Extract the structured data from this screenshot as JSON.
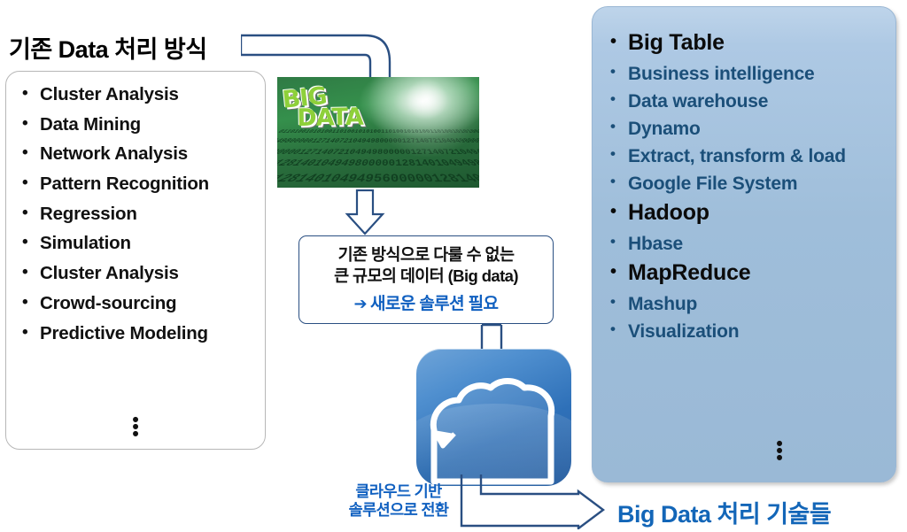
{
  "left": {
    "title": "기존 Data 처리 방식",
    "items": [
      "Cluster Analysis",
      "Data Mining",
      "Network Analysis",
      "Pattern Recognition",
      "Regression",
      "Simulation",
      "Cluster Analysis",
      "Crowd-sourcing",
      "Predictive Modeling"
    ],
    "continuation": "⋮"
  },
  "center": {
    "image_alt": "big-data-binary-image",
    "image_word_line1": "BIG",
    "image_word_line2": "DATA",
    "box_line1": "기존 방식으로 다룰 수 없는",
    "box_line2": "큰 규모의 데이터 (Big data)",
    "box_line3_arrow": "➔",
    "box_line3": "새로운 솔루션 필요",
    "cloud_alt": "cloud-icon",
    "cloud_caption_line1": "클라우드 기반",
    "cloud_caption_line2": "솔루션으로 전환"
  },
  "right": {
    "items": [
      {
        "label": "Big Table",
        "highlight": true
      },
      {
        "label": "Business intelligence",
        "highlight": false
      },
      {
        "label": "Data warehouse",
        "highlight": false
      },
      {
        "label": "Dynamo",
        "highlight": false
      },
      {
        "label": "Extract, transform & load",
        "highlight": false
      },
      {
        "label": "Google File System",
        "highlight": false
      },
      {
        "label": "Hadoop",
        "highlight": true
      },
      {
        "label": "Hbase",
        "highlight": false
      },
      {
        "label": "MapReduce",
        "highlight": true
      },
      {
        "label": "Mashup",
        "highlight": false
      },
      {
        "label": "Visualization",
        "highlight": false
      }
    ],
    "continuation": "⋮",
    "bottom_title": "Big Data 처리 기술들"
  },
  "colors": {
    "panel_fill": "#9fbeda",
    "panel_text": "#1b4f79",
    "highlight_text": "#0b0b0b",
    "accent_blue": "#1060c0",
    "connector_blue": "#2a4f82",
    "bottom_title": "#1366b8",
    "left_box_border": "#b7b7b7",
    "image_green": "#2f7a44"
  }
}
